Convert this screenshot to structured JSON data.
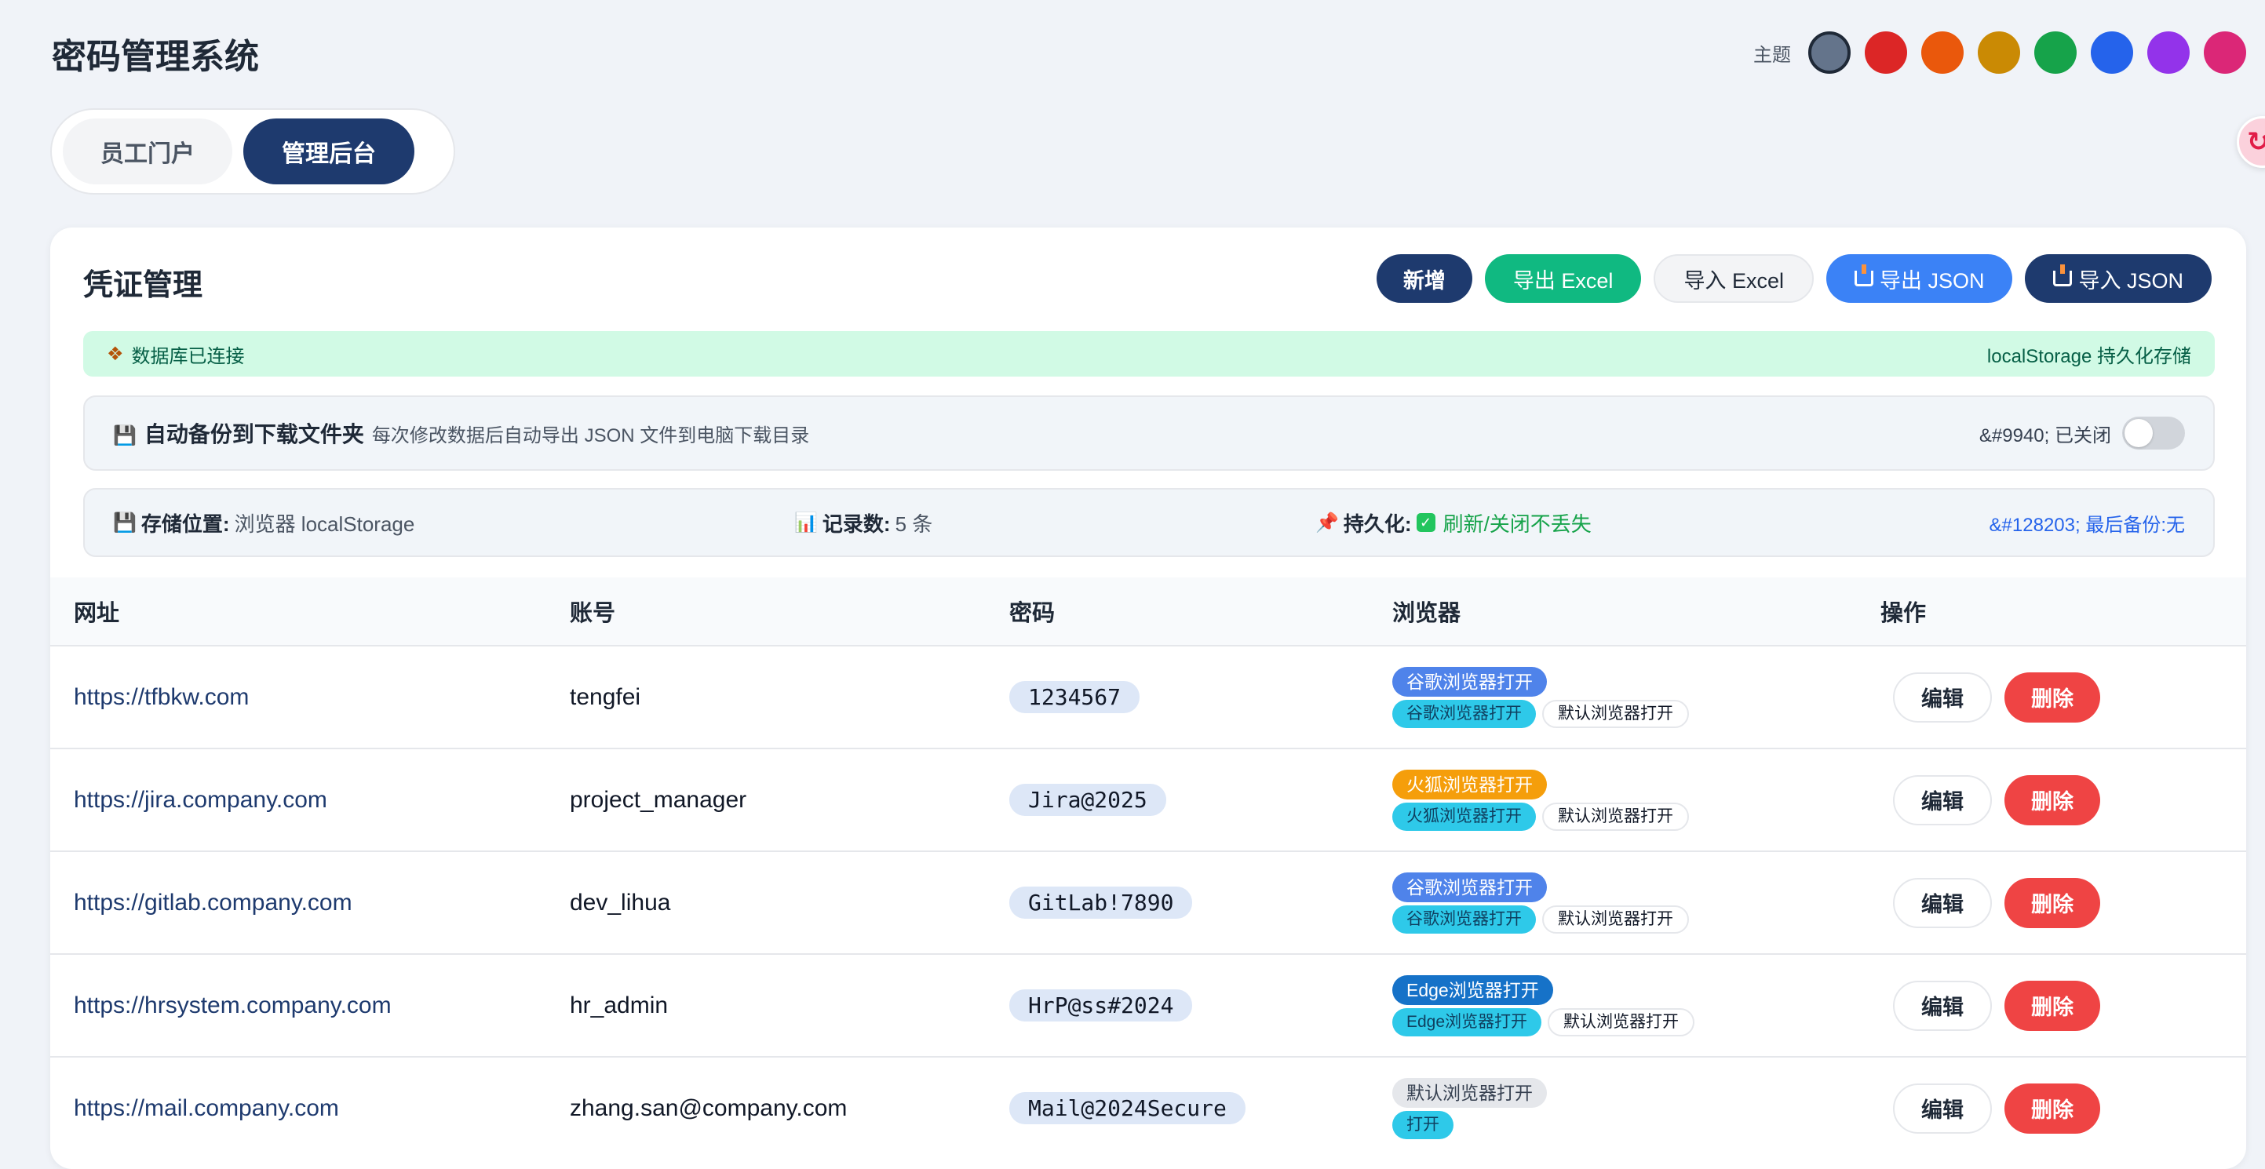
{
  "app": {
    "title": "密码管理系统"
  },
  "theme": {
    "label": "主题",
    "swatches": [
      "#64748b",
      "#dc2626",
      "#ea580c",
      "#ca8a04",
      "#16a34a",
      "#2563eb",
      "#9333ea",
      "#db2777"
    ],
    "selected": 0
  },
  "mode": {
    "employee_label": "员工门户",
    "admin_label": "管理后台",
    "active": "admin"
  },
  "credentials": {
    "title": "凭证管理",
    "toolbar": {
      "add": "新增",
      "export_excel": "导出 Excel",
      "import_excel": "导入 Excel",
      "export_json": "导出 JSON",
      "import_json": "导入 JSON"
    },
    "db_status": {
      "text": "数据库已连接",
      "right": "localStorage 持久化存储"
    },
    "backup": {
      "title": "自动备份到下载文件夹",
      "desc": "每次修改数据后自动导出 JSON 文件到电脑下载目录",
      "status": "&#9940; 已关闭",
      "enabled": false
    },
    "info": {
      "storage_label": "存储位置:",
      "storage_value": "浏览器 localStorage",
      "count_label": "记录数:",
      "count_value": "5 条",
      "persist_label": "持久化:",
      "persist_value": "刷新/关闭不丢失",
      "last_backup": "&#128203; 最后备份:无"
    },
    "columns": [
      "网址",
      "账号",
      "密码",
      "浏览器",
      "操作"
    ],
    "rows": [
      {
        "url": "https://tfbkw.com",
        "account": "tengfei",
        "password": "1234567",
        "browser_tag": "谷歌浏览器打开",
        "browser_color": "blue",
        "open_tag": "谷歌浏览器打开",
        "default_tag": "默认浏览器打开"
      },
      {
        "url": "https://jira.company.com",
        "account": "project_manager",
        "password": "Jira@2025",
        "browser_tag": "火狐浏览器打开",
        "browser_color": "orange",
        "open_tag": "火狐浏览器打开",
        "default_tag": "默认浏览器打开"
      },
      {
        "url": "https://gitlab.company.com",
        "account": "dev_lihua",
        "password": "GitLab!7890",
        "browser_tag": "谷歌浏览器打开",
        "browser_color": "blue",
        "open_tag": "谷歌浏览器打开",
        "default_tag": "默认浏览器打开"
      },
      {
        "url": "https://hrsystem.company.com",
        "account": "hr_admin",
        "password": "HrP@ss#2024",
        "browser_tag": "Edge浏览器打开",
        "browser_color": "edge",
        "open_tag": "Edge浏览器打开",
        "default_tag": "默认浏览器打开"
      },
      {
        "url": "https://mail.company.com",
        "account": "zhang.san@company.com",
        "password": "Mail@2024Secure",
        "browser_tag": "默认浏览器打开",
        "browser_color": "gray",
        "open_tag": "打开",
        "default_tag": ""
      }
    ],
    "row_actions": {
      "edit": "编辑",
      "delete": "删除"
    }
  }
}
